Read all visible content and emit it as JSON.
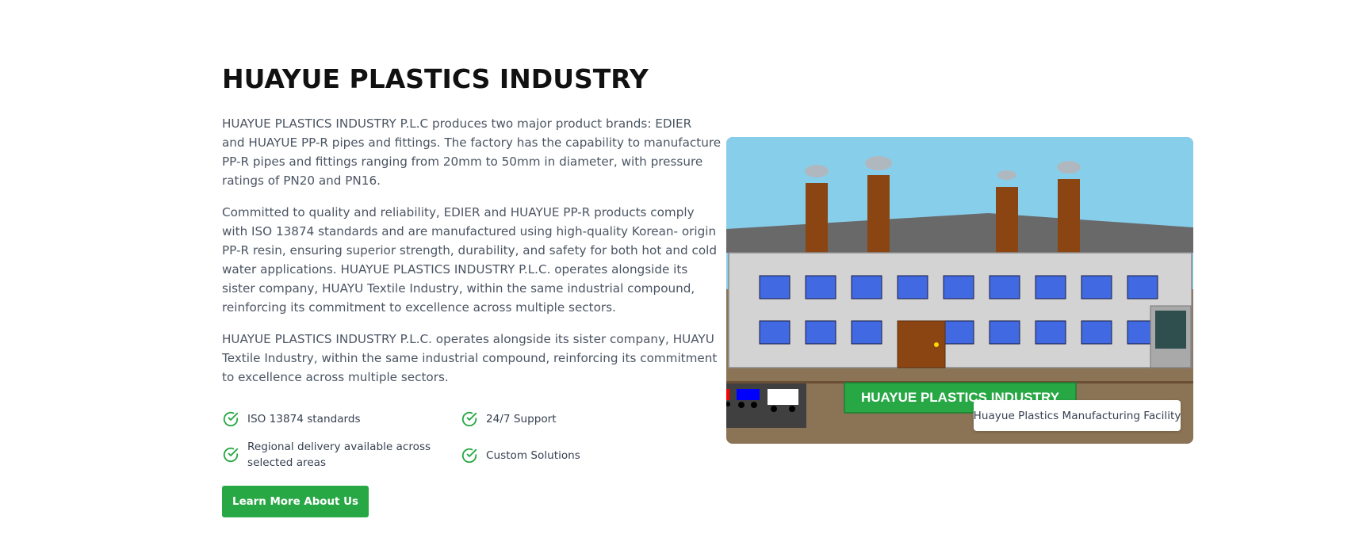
{
  "about": {
    "title": "HUAYUE PLASTICS INDUSTRY",
    "paragraph1": [
      "HUAYUE PLASTICS INDUSTRY P.L.C produces two major product brands: EDIER",
      "and HUAYUE PP-R pipes and fittings. The factory has the capability to manufacture",
      "PP-R pipes and fittings ranging from 20mm to 50mm in diameter, with pressure",
      "ratings of PN20 and PN16."
    ],
    "paragraph2": [
      "Committed to quality and reliability, EDIER and HUAYUE PP-R products comply",
      "with ISO 13874 standards and are manufactured using high-quality Korean- origin",
      "PP-R resin, ensuring superior strength, durability, and safety for both hot and cold",
      "water applications. HUAYUE PLASTICS INDUSTRY P.L.C. operates alongside its",
      "sister company, HUAYU Textile Industry, within the same industrial compound,",
      "reinforcing its commitment to excellence across multiple sectors."
    ],
    "paragraph3": [
      "HUAYUE PLASTICS INDUSTRY P.L.C. operates alongside its sister company, HUAYU",
      "Textile Industry, within the same industrial compound, reinforcing its commitment",
      "to excellence across multiple sectors."
    ],
    "features": [
      {
        "label": "ISO 13874 standards",
        "lines": [
          "ISO 13874 standards"
        ],
        "icon": "check-circle-icon"
      },
      {
        "label": "24/7 Support",
        "lines": [
          "24/7 Support"
        ],
        "icon": "check-circle-icon"
      },
      {
        "label": "Regional delivery available across selected areas",
        "lines": [
          "Regional delivery available across",
          "selected areas"
        ],
        "icon": "check-circle-icon"
      },
      {
        "label": "Custom Solutions",
        "lines": [
          "Custom Solutions"
        ],
        "icon": "check-circle-icon"
      }
    ],
    "cta_label": "Learn More About Us"
  },
  "illustration": {
    "sign_text": "HUAYUE PLASTICS INDUSTRY",
    "caption": "Huayue Plastics Manufacturing Facility"
  },
  "colors": {
    "accent": "#28a745",
    "sky": "#87ceeb",
    "roof": "#696969",
    "building": "#d3d3d3",
    "window": "#4169e1",
    "chimney": "#8b4513",
    "ground": "#8b7355"
  }
}
